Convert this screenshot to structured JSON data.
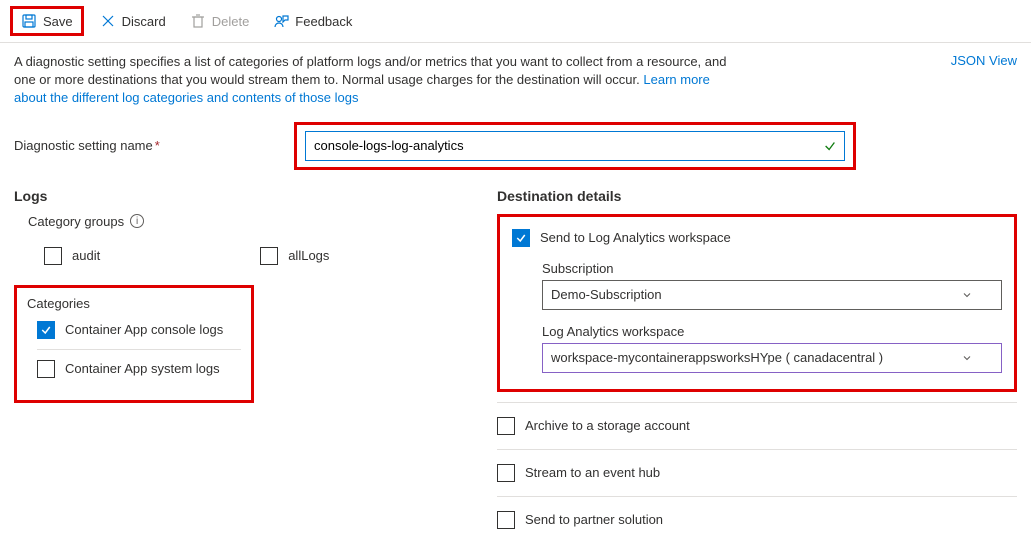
{
  "toolbar": {
    "save": "Save",
    "discard": "Discard",
    "delete": "Delete",
    "feedback": "Feedback"
  },
  "description": {
    "text1": "A diagnostic setting specifies a list of categories of platform logs and/or metrics that you want to collect from a resource, and one or more destinations that you would stream them to. Normal usage charges for the destination will occur. ",
    "link": "Learn more about the different log categories and contents of those logs"
  },
  "jsonView": "JSON View",
  "settingName": {
    "label": "Diagnostic setting name",
    "value": "console-logs-log-analytics"
  },
  "logs": {
    "heading": "Logs",
    "categoryGroups": "Category groups",
    "audit": "audit",
    "allLogs": "allLogs",
    "categories": "Categories",
    "consoleLogs": "Container App console logs",
    "systemLogs": "Container App system logs"
  },
  "destination": {
    "heading": "Destination details",
    "sendLogAnalytics": "Send to Log Analytics workspace",
    "subscriptionLabel": "Subscription",
    "subscriptionValue": "Demo-Subscription",
    "workspaceLabel": "Log Analytics workspace",
    "workspaceValue": "workspace-mycontainerappsworksHYpe ( canadacentral )",
    "archive": "Archive to a storage account",
    "stream": "Stream to an event hub",
    "partner": "Send to partner solution"
  }
}
